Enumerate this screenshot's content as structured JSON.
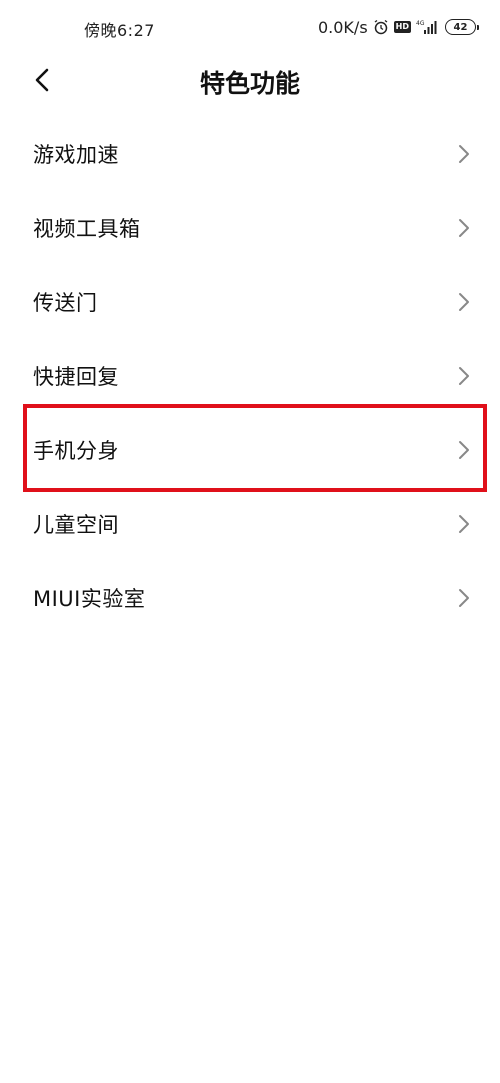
{
  "status_bar": {
    "time": "傍晚6:27",
    "net_speed": "0.0K/s",
    "hd_badge": "HD",
    "battery": "42"
  },
  "header": {
    "title": "特色功能",
    "back_icon": "chevron-left-icon"
  },
  "menu": {
    "items": [
      {
        "label": "游戏加速"
      },
      {
        "label": "视频工具箱"
      },
      {
        "label": "传送门"
      },
      {
        "label": "快捷回复"
      },
      {
        "label": "手机分身"
      },
      {
        "label": "儿童空间"
      },
      {
        "label": "MIUI实验室"
      }
    ],
    "highlighted_item": "手机分身"
  },
  "colors": {
    "highlight": "#e0101a",
    "text": "#111111",
    "chevron": "#888888"
  }
}
